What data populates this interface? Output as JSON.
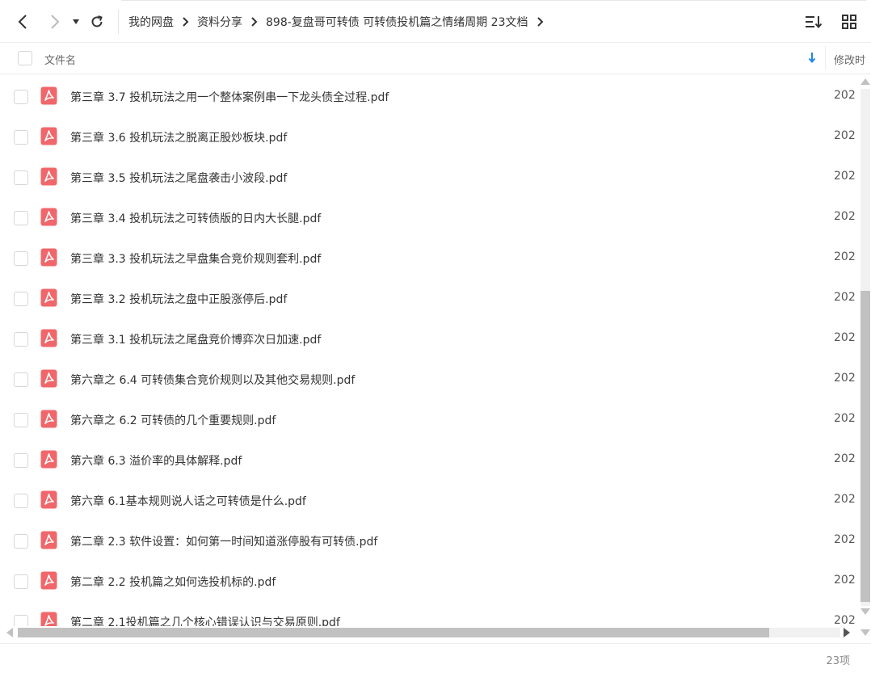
{
  "breadcrumbs": [
    "我的网盘",
    "资料分享",
    "898-复盘哥可转债 可转债投机篇之情绪周期 23文档"
  ],
  "header": {
    "name_label": "文件名",
    "time_label": "修改时"
  },
  "files": [
    {
      "name": "第三章 3.7 投机玩法之用一个整体案例串一下龙头债全过程.pdf",
      "date": "202"
    },
    {
      "name": "第三章 3.6 投机玩法之脱离正股炒板块.pdf",
      "date": "202"
    },
    {
      "name": "第三章 3.5 投机玩法之尾盘袭击小波段.pdf",
      "date": "202"
    },
    {
      "name": "第三章 3.4 投机玩法之可转债版的日内大长腿.pdf",
      "date": "202"
    },
    {
      "name": "第三章 3.3 投机玩法之早盘集合竞价规则套利.pdf",
      "date": "202"
    },
    {
      "name": "第三章 3.2 投机玩法之盘中正股涨停后.pdf",
      "date": "202"
    },
    {
      "name": "第三章 3.1 投机玩法之尾盘竞价博弈次日加速.pdf",
      "date": "202"
    },
    {
      "name": "第六章之 6.4 可转债集合竞价规则以及其他交易规则.pdf",
      "date": "202"
    },
    {
      "name": "第六章之 6.2 可转债的几个重要规则.pdf",
      "date": "202"
    },
    {
      "name": "第六章 6.3 溢价率的具体解释.pdf",
      "date": "202"
    },
    {
      "name": "第六章 6.1基本规则说人话之可转债是什么.pdf",
      "date": "202"
    },
    {
      "name": "第二章 2.3 软件设置：如何第一时间知道涨停股有可转债.pdf",
      "date": "202"
    },
    {
      "name": "第二章 2.2 投机篇之如何选投机标的.pdf",
      "date": "202"
    },
    {
      "name": "第二章 2.1投机篇之几个核心错误认识与交易原则.pdf",
      "date": "202"
    }
  ],
  "footer": {
    "count": "23项"
  },
  "colors": {
    "pdf_icon": "#f0676b",
    "sort_arrow": "#1e88e5"
  }
}
